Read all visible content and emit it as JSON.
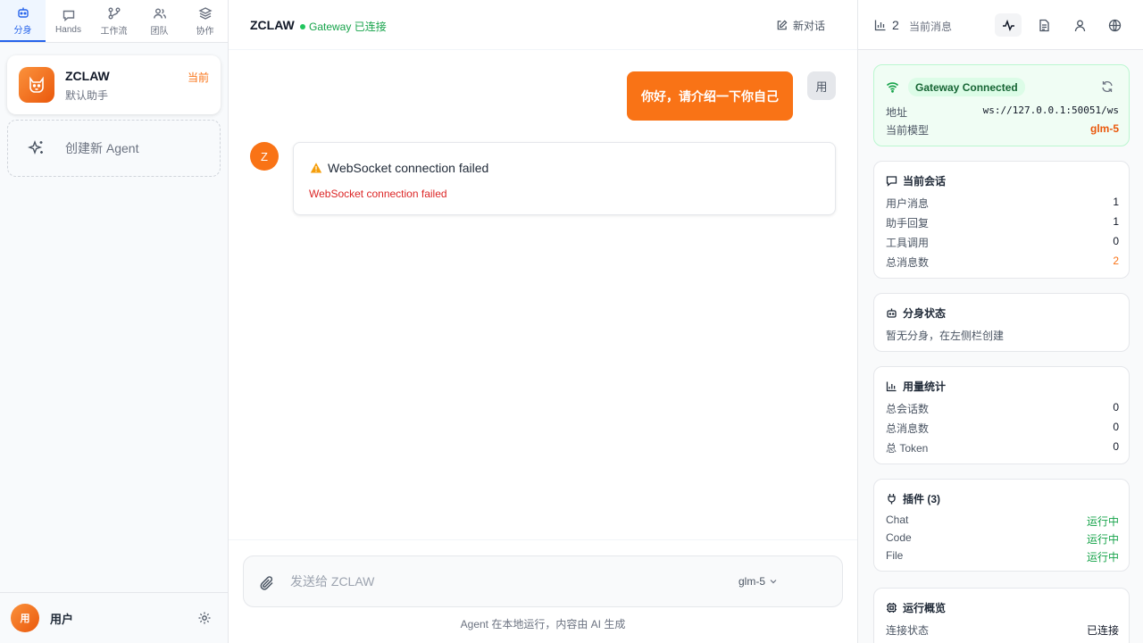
{
  "sidebar": {
    "tabs": [
      {
        "label": "分身",
        "icon": "bot-icon",
        "active": true
      },
      {
        "label": "Hands",
        "icon": "chat-icon",
        "active": false
      },
      {
        "label": "工作流",
        "icon": "workflow-icon",
        "active": false
      },
      {
        "label": "团队",
        "icon": "team-icon",
        "active": false
      },
      {
        "label": "协作",
        "icon": "layers-icon",
        "active": false
      }
    ],
    "agent": {
      "name": "ZCLAW",
      "description": "默认助手",
      "current_label": "当前"
    },
    "create_agent_label": "创建新 Agent",
    "user": {
      "avatar_text": "用",
      "name": "用户"
    }
  },
  "main": {
    "header": {
      "title": "ZCLAW",
      "gateway_status": "Gateway 已连接",
      "new_chat_label": "新对话"
    },
    "messages": {
      "user": {
        "text": "你好，请介绍一下你自己",
        "avatar_text": "用"
      },
      "assistant": {
        "avatar_text": "Z",
        "error_title": "WebSocket connection failed",
        "error_detail": "WebSocket connection failed"
      }
    },
    "input": {
      "placeholder": "发送给 ZCLAW",
      "value": "",
      "model": "glm-5",
      "disclaimer": "Agent 在本地运行，内容由 AI 生成"
    }
  },
  "right_panel": {
    "header": {
      "message_count": "2",
      "message_label": "当前消息"
    },
    "gateway": {
      "status": "Gateway Connected",
      "address_label": "地址",
      "address": "ws://127.0.0.1:50051/ws",
      "model_label": "当前模型",
      "model": "glm-5"
    },
    "session": {
      "title": "当前会话",
      "rows": [
        {
          "label": "用户消息",
          "value": "1"
        },
        {
          "label": "助手回复",
          "value": "1"
        },
        {
          "label": "工具调用",
          "value": "0"
        },
        {
          "label": "总消息数",
          "value": "2"
        }
      ]
    },
    "clone_status": {
      "title": "分身状态",
      "text": "暂无分身，在左侧栏创建"
    },
    "usage": {
      "title": "用量统计",
      "rows": [
        {
          "label": "总会话数",
          "value": "0"
        },
        {
          "label": "总消息数",
          "value": "0"
        },
        {
          "label": "总 Token",
          "value": "0"
        }
      ]
    },
    "plugins": {
      "title": "插件 (3)",
      "rows": [
        {
          "label": "Chat",
          "value": "运行中"
        },
        {
          "label": "Code",
          "value": "运行中"
        },
        {
          "label": "File",
          "value": "运行中"
        }
      ]
    },
    "overview": {
      "title": "运行概览",
      "rows": [
        {
          "label": "连接状态",
          "value": "已连接"
        }
      ]
    }
  },
  "colors": {
    "accent": "#f97316",
    "nav_active": "#2563eb",
    "success": "#16a34a",
    "error": "#dc2626"
  }
}
